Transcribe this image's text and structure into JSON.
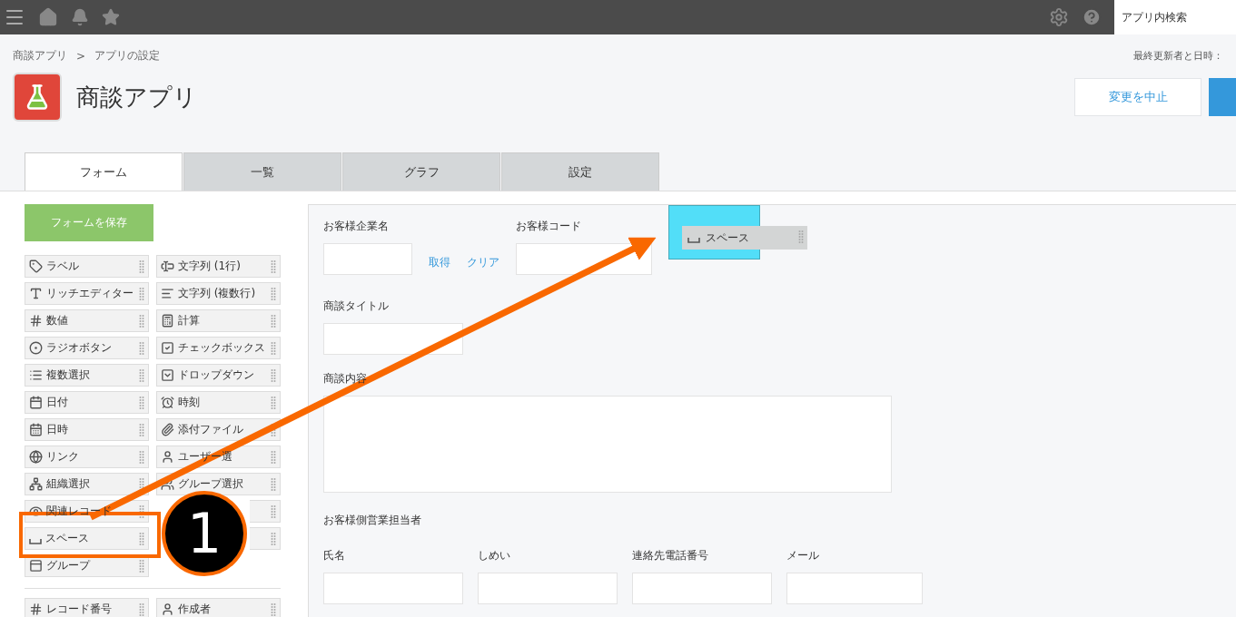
{
  "topbar": {
    "search_placeholder": "アプリ内検索"
  },
  "breadcrumb": {
    "items": [
      "商談アプリ",
      "アプリの設定"
    ],
    "separator": ">"
  },
  "meta_label": "最終更新者と日時：",
  "app_title": "商談アプリ",
  "actions": {
    "cancel": "変更を中止"
  },
  "tabs": [
    {
      "label": "フォーム",
      "selected": true
    },
    {
      "label": "一覧",
      "selected": false
    },
    {
      "label": "グラフ",
      "selected": false
    },
    {
      "label": "設定",
      "selected": false
    }
  ],
  "save_button": "フォームを保存",
  "palette_items": [
    {
      "kind": "tag",
      "label": "ラベル"
    },
    {
      "kind": "textline",
      "label": "文字列 (1行)"
    },
    {
      "kind": "rich",
      "label": "リッチエディター"
    },
    {
      "kind": "textarea",
      "label": "文字列 (複数行)"
    },
    {
      "kind": "number",
      "label": "数値"
    },
    {
      "kind": "calc",
      "label": "計算"
    },
    {
      "kind": "radio",
      "label": "ラジオボタン"
    },
    {
      "kind": "checkbox",
      "label": "チェックボックス"
    },
    {
      "kind": "list",
      "label": "複数選択"
    },
    {
      "kind": "dropdown",
      "label": "ドロップダウン"
    },
    {
      "kind": "date",
      "label": "日付"
    },
    {
      "kind": "time",
      "label": "時刻"
    },
    {
      "kind": "datetime",
      "label": "日時"
    },
    {
      "kind": "file",
      "label": "添付ファイル"
    },
    {
      "kind": "link",
      "label": "リンク"
    },
    {
      "kind": "user",
      "label": "ユーザー選"
    },
    {
      "kind": "org",
      "label": "組織選択"
    },
    {
      "kind": "users",
      "label": "グループ選択"
    },
    {
      "kind": "related",
      "label": "関連レコード"
    },
    {
      "kind": "none"
    },
    {
      "kind": "space",
      "label": "スペース"
    },
    {
      "kind": "none"
    },
    {
      "kind": "group",
      "label": "グループ"
    }
  ],
  "system_palette": [
    {
      "kind": "number",
      "label": "レコード番号"
    },
    {
      "kind": "user",
      "label": "作成者"
    }
  ],
  "form": {
    "row1": {
      "company": {
        "label": "お客様企業名",
        "links": [
          "取得",
          "クリア"
        ]
      },
      "code": {
        "label": "お客様コード"
      },
      "drop_ghost": "スペース"
    },
    "title_field": "商談タイトル",
    "content_field": "商談内容",
    "group_label": "お客様側営業担当者",
    "contact_fields": [
      "氏名",
      "しめい",
      "連絡先電話番号",
      "メール"
    ]
  },
  "annotation": {
    "step": "1"
  }
}
